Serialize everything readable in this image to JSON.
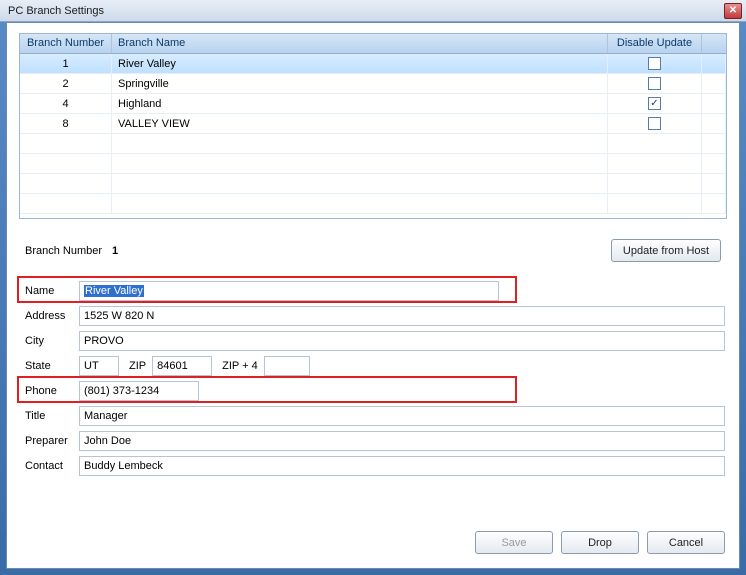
{
  "window": {
    "title": "PC Branch Settings"
  },
  "grid": {
    "headers": {
      "number": "Branch Number",
      "name": "Branch Name",
      "disable": "Disable Update"
    },
    "rows": [
      {
        "number": "1",
        "name": "River Valley",
        "disable": false,
        "selected": true
      },
      {
        "number": "2",
        "name": "Springville",
        "disable": false,
        "selected": false
      },
      {
        "number": "4",
        "name": "Highland",
        "disable": true,
        "selected": false
      },
      {
        "number": "8",
        "name": "VALLEY VIEW",
        "disable": false,
        "selected": false
      }
    ]
  },
  "detail": {
    "branch_number_label": "Branch Number",
    "branch_number_value": "1",
    "update_from_host": "Update from Host",
    "fields": {
      "name_label": "Name",
      "name_value": "River Valley",
      "address_label": "Address",
      "address_value": "1525 W 820 N",
      "city_label": "City",
      "city_value": "PROVO",
      "state_label": "State",
      "state_value": "UT",
      "zip_label": "ZIP",
      "zip_value": "84601",
      "zip4_label": "ZIP + 4",
      "zip4_value": "",
      "phone_label": "Phone",
      "phone_value": "(801) 373-1234",
      "title_label": "Title",
      "title_value": "Manager",
      "preparer_label": "Preparer",
      "preparer_value": "John Doe",
      "contact_label": "Contact",
      "contact_value": "Buddy Lembeck"
    }
  },
  "buttons": {
    "save": "Save",
    "drop": "Drop",
    "cancel": "Cancel"
  }
}
